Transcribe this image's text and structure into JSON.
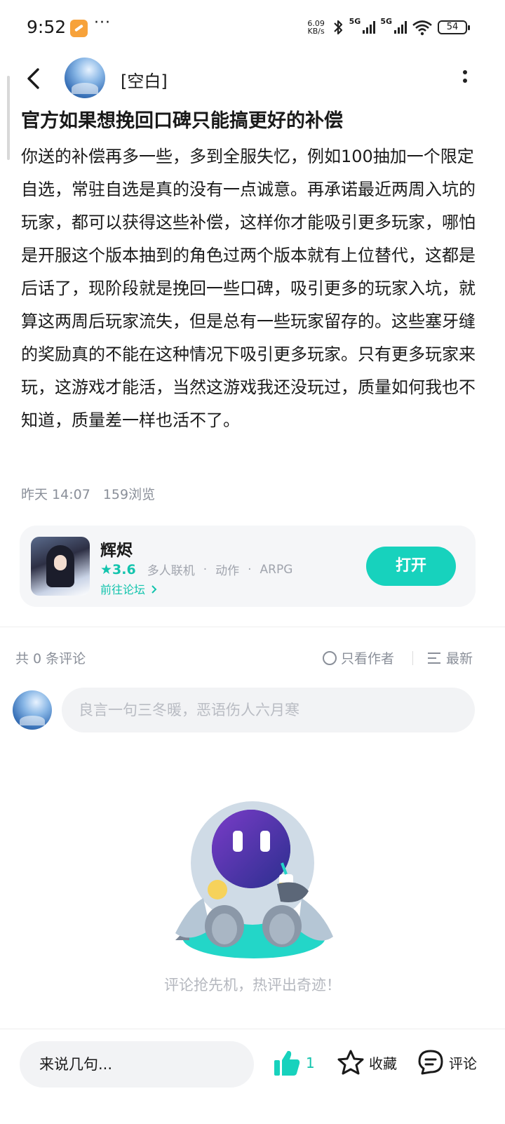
{
  "status_bar": {
    "time": "9:52",
    "net_speed_value": "6.09",
    "net_speed_unit": "KB/s",
    "network_1": "5G",
    "network_2": "5G",
    "battery": "54"
  },
  "header": {
    "nickname": "[空白]"
  },
  "post": {
    "title": "官方如果想挽回口碑只能搞更好的补偿",
    "body": "你送的补偿再多一些，多到全服失忆，例如100抽加一个限定自选，常驻自选是真的没有一点诚意。再承诺最近两周入坑的玩家，都可以获得这些补偿，这样你才能吸引更多玩家，哪怕是开服这个版本抽到的角色过两个版本就有上位替代，这都是后话了，现阶段就是挽回一些口碑，吸引更多的玩家入坑，就算这两周后玩家流失，但是总有一些玩家留存的。这些塞牙缝的奖励真的不能在这种情况下吸引更多玩家。只有更多玩家来玩，这游戏才能活，当然这游戏我还没玩过，质量如何我也不知道，质量差一样也活不了。",
    "time": "昨天 14:07",
    "views": "159浏览"
  },
  "game_card": {
    "name": "辉烬",
    "rating": "3.6",
    "tags": [
      "多人联机",
      "动作",
      "ARPG"
    ],
    "tag_separator": "·",
    "forum_link": "前往论坛",
    "open_label": "打开"
  },
  "comments": {
    "count_label": "共 0 条评论",
    "author_only_label": "只看作者",
    "sort_label": "最新",
    "input_placeholder": "良言一句三冬暖，恶语伤人六月寒",
    "empty_text": "评论抢先机，热评出奇迹！"
  },
  "bottom_bar": {
    "reply_placeholder": "来说几句...",
    "like_count": "1",
    "favorite_label": "收藏",
    "comment_label": "评论"
  },
  "colors": {
    "accent": "#17d2bd",
    "accent_text": "#13c4ad",
    "muted_text": "#8a8f99"
  }
}
